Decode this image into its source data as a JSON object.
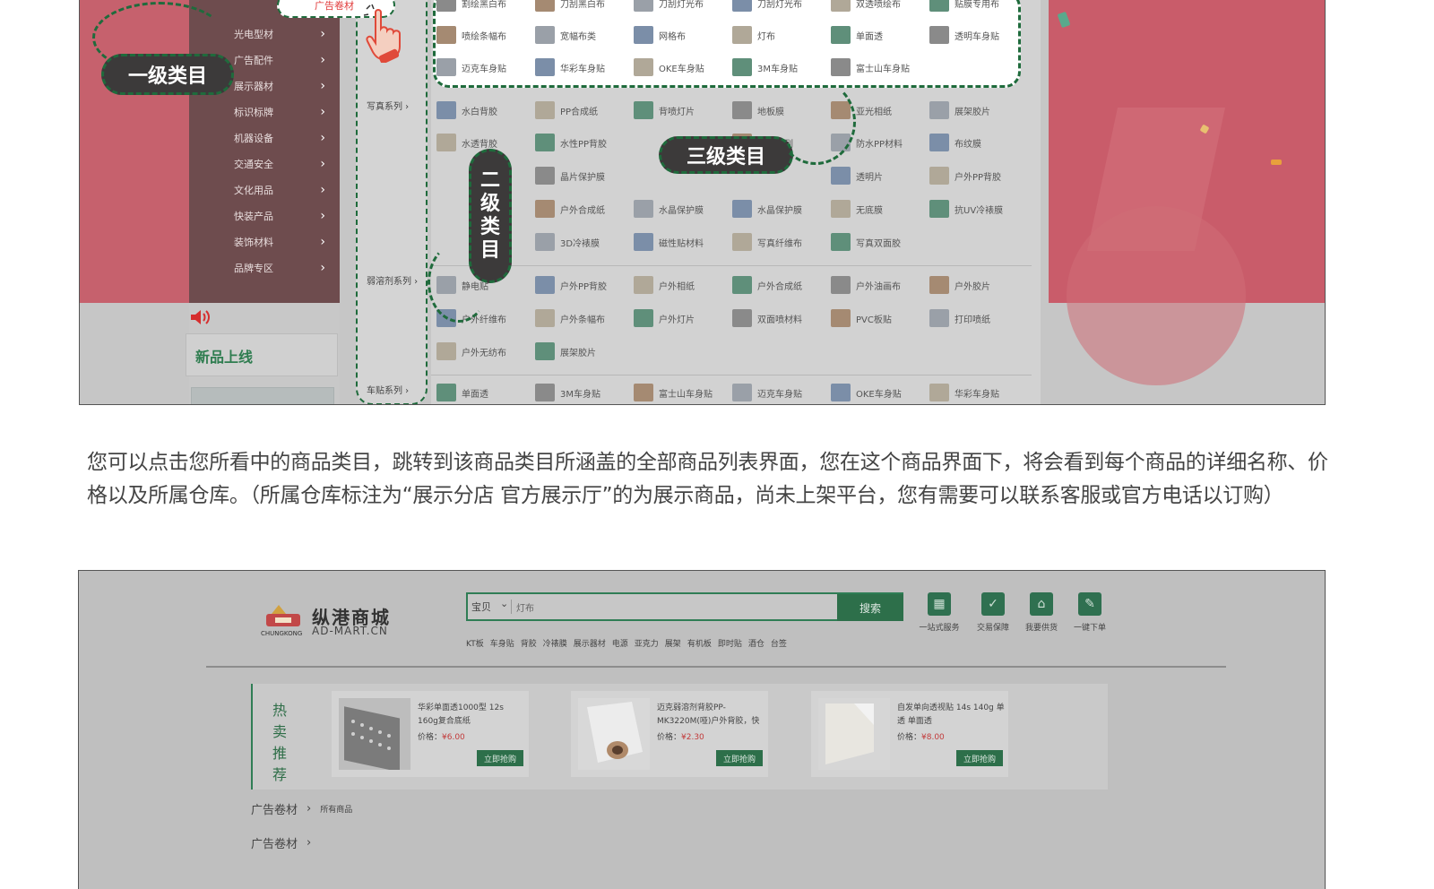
{
  "top_screenshot": {
    "first_level_menu": [
      {
        "label": "广告卷材"
      },
      {
        "label": "光电型材"
      },
      {
        "label": "广告配件"
      },
      {
        "label": "展示器材"
      },
      {
        "label": "标识标牌"
      },
      {
        "label": "机器设备"
      },
      {
        "label": "交通安全"
      },
      {
        "label": "文化用品"
      },
      {
        "label": "快装产品"
      },
      {
        "label": "装饰材料"
      },
      {
        "label": "品牌专区"
      }
    ],
    "second_level": [
      "写真系列",
      "弱溶剂系列",
      "车贴系列"
    ],
    "third_level_rows": [
      [
        "割绘黑白布",
        "刀刮黑白布",
        "刀刮灯光布",
        "刀刮灯光布",
        "双透喷绘布",
        "贴膜专用布"
      ],
      [
        "喷绘条幅布",
        "宽幅布类",
        "网格布",
        "灯布",
        "单面透",
        "透明车身贴"
      ],
      [
        "迈克车身贴",
        "华彩车身贴",
        "OKE车身贴",
        "3M车身贴",
        "富士山车身贴"
      ],
      [
        "水白背胶",
        "PP合成纸",
        "背喷灯片",
        "地板膜",
        "亚光相纸",
        "展架胶片"
      ],
      [
        "水透背胶",
        "水性PP背胶",
        "",
        "相纸系列",
        "防水PP材料",
        "布纹膜"
      ],
      [
        "",
        "晶片保护膜",
        "",
        "",
        "透明片",
        "户外PP背胶"
      ],
      [
        "",
        "户外合成纸",
        "水晶保护膜",
        "水晶保护膜",
        "无底膜",
        "抗UV冷裱膜"
      ],
      [
        "",
        "3D冷裱膜",
        "磁性贴材料",
        "写真纤维布",
        "写真双面胶",
        ""
      ],
      [
        "静电贴",
        "户外PP背胶",
        "户外相纸",
        "户外合成纸",
        "户外油画布",
        "户外胶片"
      ],
      [
        "户外纤维布",
        "户外条幅布",
        "户外灯片",
        "双面喷材料",
        "PVC板贴",
        "打印喷纸"
      ],
      [
        "户外无纺布",
        "展架胶片"
      ],
      [
        "单面透",
        "3M车身贴",
        "富士山车身贴",
        "迈克车身贴",
        "OKE车身贴",
        "华彩车身贴"
      ]
    ],
    "new_products_title": "新品上线",
    "annotations": {
      "level1": "一级类目",
      "level2": [
        "二",
        "级",
        "类",
        "目"
      ],
      "level3": "三级类目"
    }
  },
  "description": "您可以点击您所看中的商品类目，跳转到该商品类目所涵盖的全部商品列表界面，您在这个商品界面下，将会看到每个商品的详细名称、价格以及所属仓库。（所属仓库标注为“展示分店 官方展示厅”的为展示商品，尚未上架平台，您有需要可以联系客服或官方电话以订购）",
  "bottom_screenshot": {
    "logo": {
      "cn": "纵港商城",
      "en": "AD-MART.CN",
      "sub": "CHUNGKONG"
    },
    "search": {
      "select": "宝贝",
      "query": "灯布",
      "button": "搜索"
    },
    "hot_words": [
      "KT板",
      "车身贴",
      "背胶",
      "冷裱膜",
      "展示器材",
      "电源",
      "亚克力",
      "展架",
      "有机板",
      "即时贴",
      "酒仓",
      "台签"
    ],
    "services": [
      {
        "label": "一站式服务",
        "icon": "shop-icon"
      },
      {
        "label": "交易保障",
        "icon": "shield-icon"
      },
      {
        "label": "我要供货",
        "icon": "house-icon"
      },
      {
        "label": "一键下单",
        "icon": "edit-icon"
      }
    ],
    "hot_title": [
      "热",
      "卖",
      "推",
      "荐"
    ],
    "products": [
      {
        "name": "华彩单面透1000型 12s 160g复合底纸",
        "price_label": "价格：",
        "price": "¥6.00",
        "buy": "立即抢购"
      },
      {
        "name": "迈克弱溶剂背胶PP-MK3220M(哑)户外背胶，快",
        "price_label": "价格：",
        "price": "¥2.30",
        "buy": "立即抢购"
      },
      {
        "name": "自发单向透视贴 14s 140g 单透 单面透",
        "price_label": "价格：",
        "price": "¥8.00",
        "buy": "立即抢购"
      }
    ],
    "breadcrumbs": [
      {
        "label": "广告卷材",
        "sub": "所有商品"
      },
      {
        "label": "广告卷材",
        "sub": ""
      }
    ]
  }
}
